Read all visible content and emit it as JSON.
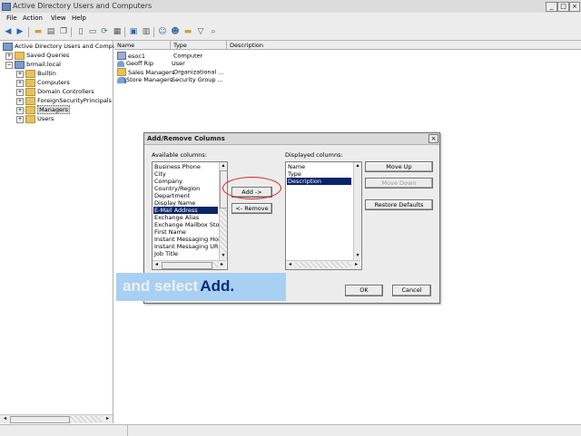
{
  "window": {
    "title": "Active Directory Users and Computers",
    "controls": [
      "_",
      "□",
      "×"
    ]
  },
  "menu": [
    "File",
    "Action",
    "View",
    "Help"
  ],
  "toolbar": [
    "back-icon",
    "forward-icon",
    "up-folder-icon",
    "properties-icon",
    "copy-icon",
    "cut-icon",
    "delete-icon",
    "refresh-icon",
    "export-icon",
    "help-icon",
    "user-icon",
    "group-icon",
    "ou-icon",
    "filter-icon",
    "find-icon"
  ],
  "tree": {
    "root": "Active Directory Users and Comput...",
    "items": [
      {
        "label": "Saved Queries",
        "level": 1,
        "expander": "+"
      },
      {
        "label": "brmail.local",
        "level": 1,
        "expander": "−"
      },
      {
        "label": "Builtin",
        "level": 2,
        "expander": "+"
      },
      {
        "label": "Computers",
        "level": 2,
        "expander": "+"
      },
      {
        "label": "Domain Controllers",
        "level": 2,
        "expander": "+"
      },
      {
        "label": "ForeignSecurityPrincipals",
        "level": 2,
        "expander": "+"
      },
      {
        "label": "Managers",
        "level": 2,
        "expander": "+",
        "selected": true
      },
      {
        "label": "Users",
        "level": 2,
        "expander": "+"
      }
    ]
  },
  "list": {
    "columns": [
      "Name",
      "Type",
      "Description"
    ],
    "rows": [
      {
        "name": "esoc1",
        "type": "Computer",
        "icon": "computer-icon"
      },
      {
        "name": "Geoff Rip",
        "type": "User",
        "icon": "user-icon"
      },
      {
        "name": "Sales Managers",
        "type": "Organizational ...",
        "icon": "ou-icon"
      },
      {
        "name": "Store Managers",
        "type": "Security Group ...",
        "icon": "group-icon"
      }
    ]
  },
  "dialog": {
    "title": "Add/Remove Columns",
    "available_label": "Available columns:",
    "available": [
      "Business Phone",
      "City",
      "Company",
      "Country/Region",
      "Department",
      "Display Name",
      "E-Mail Address",
      "Exchange Alias",
      "Exchange Mailbox Store",
      "First Name",
      "Instant Messaging Home",
      "Instant Messaging UR",
      "Job Title"
    ],
    "available_selected": "E-Mail Address",
    "displayed_label": "Displayed columns:",
    "displayed": [
      "Name",
      "Type",
      "Description"
    ],
    "displayed_selected": "Description",
    "add_button": "Add ->",
    "remove_button": "<- Remove",
    "move_up": "Move Up",
    "move_down": "Move Down",
    "restore": "Restore Defaults",
    "ok": "OK",
    "cancel": "Cancel"
  },
  "caption": {
    "part1": "and select",
    "part2": "Add."
  },
  "colors": {
    "highlight_ring": "#e02020",
    "caption_bg": "#a8d0f2",
    "selection": "#0a246a"
  }
}
